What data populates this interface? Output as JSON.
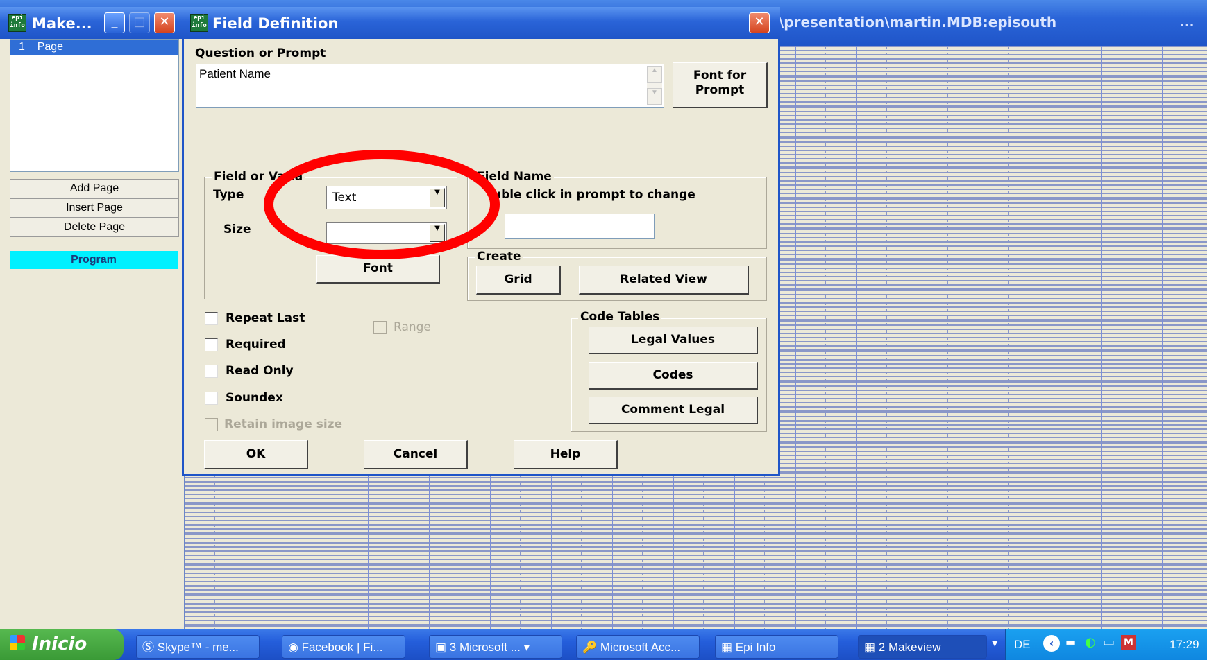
{
  "main_window": {
    "title": "\\presentation\\martin.MDB:episouth",
    "overflow": "..."
  },
  "left_panel": {
    "title": "Make...",
    "pages": [
      {
        "number": "1",
        "label": "Page"
      }
    ],
    "add_page": "Add Page",
    "insert_page": "Insert Page",
    "delete_page": "Delete Page",
    "program": "Program"
  },
  "dialog": {
    "title": "Field Definition",
    "question_label": "Question or Prompt",
    "question_value": "Patient Name",
    "font_for_prompt": "Font for Prompt",
    "field_group": "Field or Varia",
    "type_label": "Type",
    "type_value": "Text",
    "size_label": "Size",
    "size_value": "",
    "font_button": "Font",
    "field_name_group": "Field Name",
    "field_name_hint": "uble click in prompt to change",
    "field_name_value": "",
    "create_group": "Create",
    "grid_button": "Grid",
    "related_view_button": "Related View",
    "checkboxes": {
      "repeat_last": "Repeat Last",
      "required": "Required",
      "read_only": "Read Only",
      "soundex": "Soundex",
      "retain_image": "Retain image size",
      "range": "Range"
    },
    "code_tables_group": "Code Tables",
    "legal_values": "Legal Values",
    "codes": "Codes",
    "comment_legal": "Comment Legal",
    "ok": "OK",
    "cancel": "Cancel",
    "help": "Help"
  },
  "annotation": {
    "color": "#ff0000"
  },
  "taskbar": {
    "start": "Inicio",
    "tasks": [
      "Skype™ - me...",
      "Facebook | Fi...",
      "3 Microsoft ...",
      "Microsoft Acc...",
      "Epi Info",
      "2 Makeview"
    ],
    "language": "DE",
    "clock": "17:29"
  }
}
